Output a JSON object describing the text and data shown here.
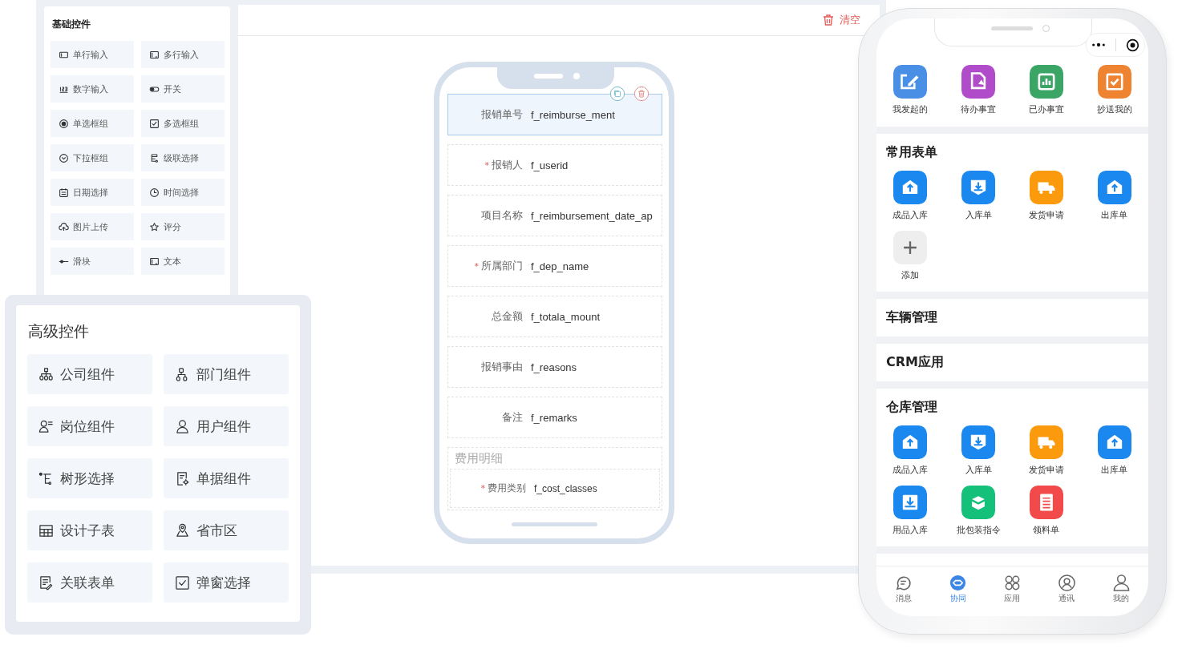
{
  "basic_controls": {
    "title": "基础控件",
    "items": [
      {
        "label": "单行输入"
      },
      {
        "label": "多行输入"
      },
      {
        "label": "数字输入"
      },
      {
        "label": "开关"
      },
      {
        "label": "单选框组"
      },
      {
        "label": "多选框组"
      },
      {
        "label": "下拉框组"
      },
      {
        "label": "级联选择"
      },
      {
        "label": "日期选择"
      },
      {
        "label": "时间选择"
      },
      {
        "label": "图片上传"
      },
      {
        "label": "评分"
      },
      {
        "label": "滑块"
      },
      {
        "label": "文本"
      }
    ]
  },
  "toolbar": {
    "clear_button": "清空"
  },
  "form_preview": {
    "fields": [
      {
        "label": "报销单号",
        "field": "f_reimburse_ment",
        "selected": true
      },
      {
        "label": "报销人",
        "field": "f_userid",
        "required_mark": "*",
        "selected": false
      },
      {
        "label": "项目名称",
        "field": "f_reimbursement_date_ap",
        "selected": false
      },
      {
        "label": "所属部门",
        "field": "f_dep_name",
        "required_mark": "*",
        "selected": false
      },
      {
        "label": "总金额",
        "field": "f_totala_mount",
        "selected": false
      },
      {
        "label": "报销事由",
        "field": "f_reasons",
        "selected": false
      },
      {
        "label": "备注",
        "field": "f_remarks",
        "selected": false
      }
    ],
    "subtable": {
      "title": "费用明细",
      "fields": [
        {
          "label": "费用类别",
          "field": "f_cost_classes",
          "required_mark": "*"
        }
      ]
    }
  },
  "advanced_controls": {
    "title": "高级控件",
    "items": [
      {
        "label": "公司组件"
      },
      {
        "label": "部门组件"
      },
      {
        "label": "岗位组件"
      },
      {
        "label": "用户组件"
      },
      {
        "label": "树形选择"
      },
      {
        "label": "单据组件"
      },
      {
        "label": "设计子表"
      },
      {
        "label": "省市区"
      },
      {
        "label": "关联表单"
      },
      {
        "label": "弹窗选择"
      }
    ]
  },
  "mobile": {
    "quick_actions": [
      {
        "label": "我发起的",
        "color": "#4a8fe6",
        "kind": "edit"
      },
      {
        "label": "待办事宜",
        "color": "#b04bc9",
        "kind": "doc"
      },
      {
        "label": "已办事宜",
        "color": "#3aa564",
        "kind": "chart"
      },
      {
        "label": "抄送我的",
        "color": "#ee8431",
        "kind": "check"
      }
    ],
    "sections": [
      {
        "title": "常用表单",
        "items": [
          {
            "label": "成品入库",
            "color": "#1b88f0",
            "kind": "box"
          },
          {
            "label": "入库单",
            "color": "#1b88f0",
            "kind": "tray"
          },
          {
            "label": "发货申请",
            "color": "#fb9a0c",
            "kind": "truck"
          },
          {
            "label": "出库单",
            "color": "#1b88f0",
            "kind": "box"
          },
          {
            "label": "添加",
            "color": "#eeeeee",
            "kind": "add"
          }
        ]
      },
      {
        "title": "车辆管理"
      },
      {
        "title": "CRM应用"
      },
      {
        "title": "仓库管理",
        "items": [
          {
            "label": "成品入库",
            "color": "#1b88f0",
            "kind": "box"
          },
          {
            "label": "入库单",
            "color": "#1b88f0",
            "kind": "tray"
          },
          {
            "label": "发货申请",
            "color": "#fb9a0c",
            "kind": "truck"
          },
          {
            "label": "出库单",
            "color": "#1b88f0",
            "kind": "box"
          },
          {
            "label": "用品入库",
            "color": "#1b88f0",
            "kind": "inbox"
          },
          {
            "label": "批包装指令",
            "color": "#14c07a",
            "kind": "package"
          },
          {
            "label": "领料单",
            "color": "#f24a4a",
            "kind": "list"
          }
        ]
      }
    ],
    "tab_bar": [
      {
        "label": "消息",
        "selected": false
      },
      {
        "label": "协同",
        "selected": true
      },
      {
        "label": "应用",
        "selected": false
      },
      {
        "label": "通讯",
        "selected": false
      },
      {
        "label": "我的",
        "selected": false
      }
    ]
  }
}
